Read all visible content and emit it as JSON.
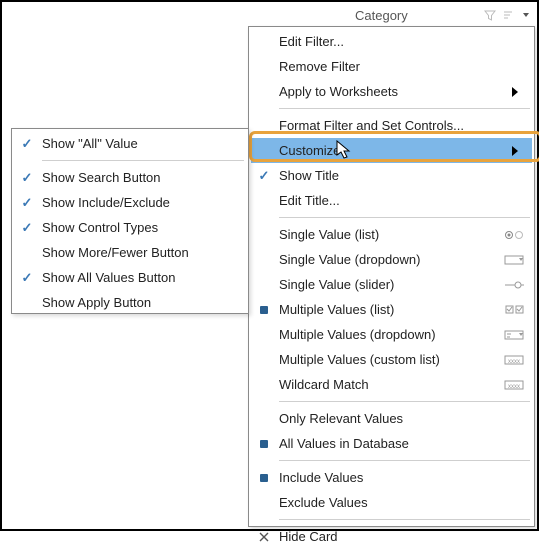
{
  "header": {
    "title": "Category"
  },
  "menu": {
    "edit_filter": "Edit Filter...",
    "remove_filter": "Remove Filter",
    "apply_worksheets": "Apply to Worksheets",
    "format_filter": "Format Filter and Set Controls...",
    "customize": "Customize",
    "show_title": "Show Title",
    "edit_title": "Edit Title...",
    "single_list": "Single Value (list)",
    "single_dropdown": "Single Value (dropdown)",
    "single_slider": "Single Value (slider)",
    "multi_list": "Multiple Values (list)",
    "multi_dropdown": "Multiple Values (dropdown)",
    "multi_custom": "Multiple Values (custom list)",
    "wildcard": "Wildcard Match",
    "only_relevant": "Only Relevant Values",
    "all_values_db": "All Values in Database",
    "include_values": "Include Values",
    "exclude_values": "Exclude Values",
    "hide_card": "Hide Card"
  },
  "submenu": {
    "show_all": "Show \"All\" Value",
    "show_search": "Show Search Button",
    "show_include_exclude": "Show Include/Exclude",
    "show_control_types": "Show Control Types",
    "show_more_fewer": "Show More/Fewer Button",
    "show_all_values_btn": "Show All Values Button",
    "show_apply": "Show Apply Button"
  }
}
